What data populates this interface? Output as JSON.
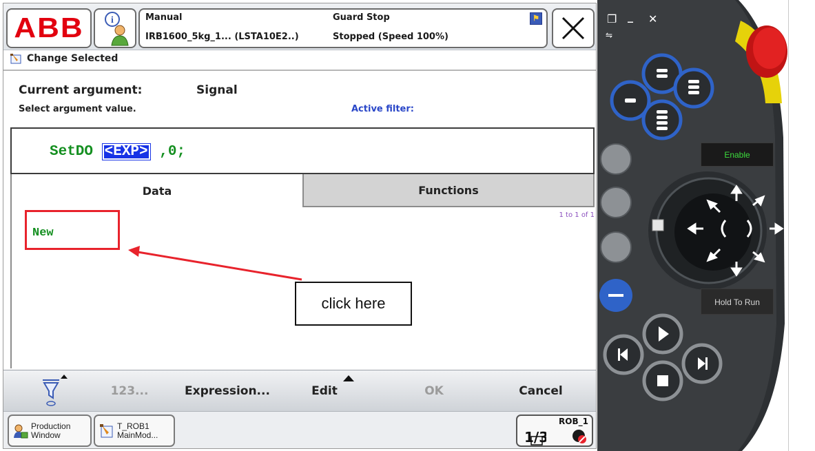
{
  "status": {
    "mode": "Manual",
    "robot": "IRB1600_5kg_1... (LSTA10E2..)",
    "guard": "Guard Stop",
    "state": "Stopped (Speed 100%)"
  },
  "header": {
    "title": "Change Selected",
    "logo": "ABB"
  },
  "argument": {
    "label": "Current argument:",
    "value": "Signal",
    "hint": "Select argument value.",
    "filter_label": "Active filter:"
  },
  "code": {
    "instruction": "SetDO ",
    "placeholder": "<EXP>",
    "rest": " ,0;"
  },
  "tabs": [
    {
      "label": "Data"
    },
    {
      "label": "Functions"
    }
  ],
  "list": {
    "count": "1 to 1 of 1",
    "items": [
      "New"
    ]
  },
  "toolbar": {
    "numeric": "123...",
    "expression": "Expression...",
    "edit": "Edit",
    "ok": "OK",
    "cancel": "Cancel"
  },
  "taskbar": {
    "production": [
      "Production",
      "Window"
    ],
    "program": [
      "T_ROB1",
      "MainMod..."
    ],
    "quickset": "ROB_1",
    "quickset_mark": "1/3"
  },
  "annotation": {
    "text": "click here"
  },
  "hardware": {
    "enable": "Enable",
    "hold": "Hold To Run"
  },
  "colors": {
    "abb_red": "#e2000f",
    "code_green": "#148f20",
    "highlight_blue": "#1733e6",
    "annotation_red": "#e8232c",
    "device_blue": "#2f63c8",
    "estop_red": "#d41a1a",
    "enable_green": "#3ddc3d"
  }
}
